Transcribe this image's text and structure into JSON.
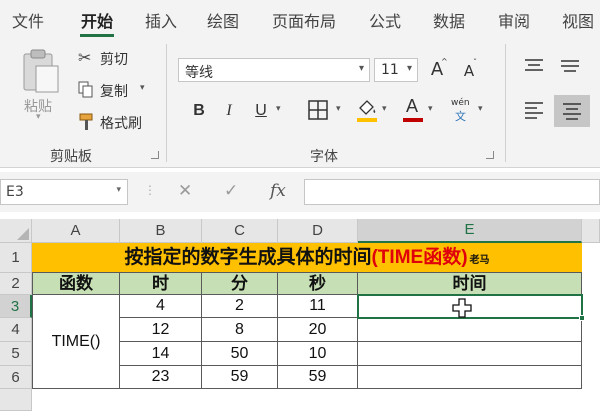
{
  "tabs": [
    "文件",
    "开始",
    "插入",
    "绘图",
    "页面布局",
    "公式",
    "数据",
    "审阅",
    "视图"
  ],
  "clipboard": {
    "paste_label": "粘贴",
    "cut_label": "剪切",
    "copy_label": "复制",
    "format_painter_label": "格式刷",
    "group_label": "剪贴板"
  },
  "font": {
    "name": "等线",
    "size": "11",
    "group_label": "字体",
    "bold": "B",
    "italic": "I",
    "underline": "U",
    "grow": "A",
    "shrink": "A",
    "font_color": "A",
    "phonetic_top": "wén",
    "phonetic_bottom": "文"
  },
  "formula_bar": {
    "name_box": "E3",
    "fx": "fx",
    "cancel": "✕",
    "enter": "✓"
  },
  "sheet": {
    "columns": [
      "A",
      "B",
      "C",
      "D",
      "E"
    ],
    "rows": [
      "1",
      "2",
      "3",
      "4",
      "5",
      "6"
    ],
    "title_main": "按指定的数字生成具体的时间",
    "title_red": "(TIME函数)",
    "title_small": "老马",
    "headers": [
      "函数",
      "时",
      "分",
      "秒",
      "时间"
    ],
    "func_name": "TIME()",
    "data": [
      [
        "4",
        "2",
        "11",
        ""
      ],
      [
        "12",
        "8",
        "20",
        ""
      ],
      [
        "14",
        "50",
        "10",
        ""
      ],
      [
        "23",
        "59",
        "59",
        ""
      ]
    ],
    "active_cell": "E3"
  },
  "colors": {
    "accent": "#217346",
    "title_fill": "#ffc000",
    "header_fill": "#c6dfb4",
    "title_red": "#e0000b",
    "font_color_bar": "#c00000",
    "fill_color_bar": "#ffc000"
  },
  "icons": [
    "paste-icon",
    "scissors-icon",
    "copy-icon",
    "format-painter-icon",
    "borders-icon",
    "fill-color-icon",
    "font-color-icon",
    "phonetic-icon",
    "align-top-icon",
    "align-middle-icon",
    "align-left-icon",
    "align-center-icon",
    "cell-cursor-icon"
  ]
}
